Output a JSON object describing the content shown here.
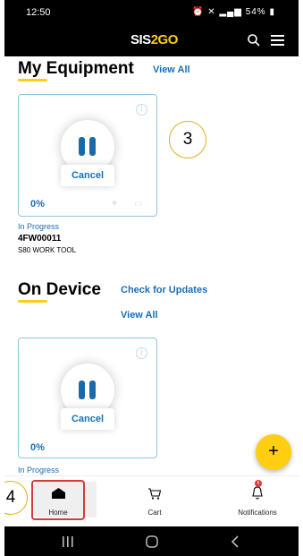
{
  "status_bar": {
    "time": "12:50",
    "battery": "54%"
  },
  "header": {
    "brand_prefix": "SIS",
    "brand_suffix": "2GO"
  },
  "equipment": {
    "title": "My Equipment",
    "view_all": "View All",
    "card": {
      "cancel_label": "Cancel",
      "percent": "0%",
      "progress_value": 0
    },
    "status": "In Progress",
    "serial": "4FW00011",
    "model": "S80 WORK TOOL"
  },
  "on_device": {
    "title": "On Device",
    "check_updates": "Check for Updates",
    "view_all": "View All",
    "card": {
      "cancel_label": "Cancel",
      "percent": "0%",
      "progress_value": 0
    },
    "status": "In Progress"
  },
  "annotations": {
    "step_3": "3",
    "step_4": "4"
  },
  "fab": {
    "label": "+"
  },
  "bottom_nav": {
    "items": [
      {
        "label": "Home",
        "icon": "home-icon"
      },
      {
        "label": "Cart",
        "icon": "cart-icon"
      },
      {
        "label": "Notifications",
        "icon": "bell-icon",
        "badge": "5"
      }
    ]
  },
  "colors": {
    "accent": "#ffcd11",
    "link": "#1a6fb5",
    "highlight": "#d63a3a",
    "card_border": "#8ec5df"
  }
}
